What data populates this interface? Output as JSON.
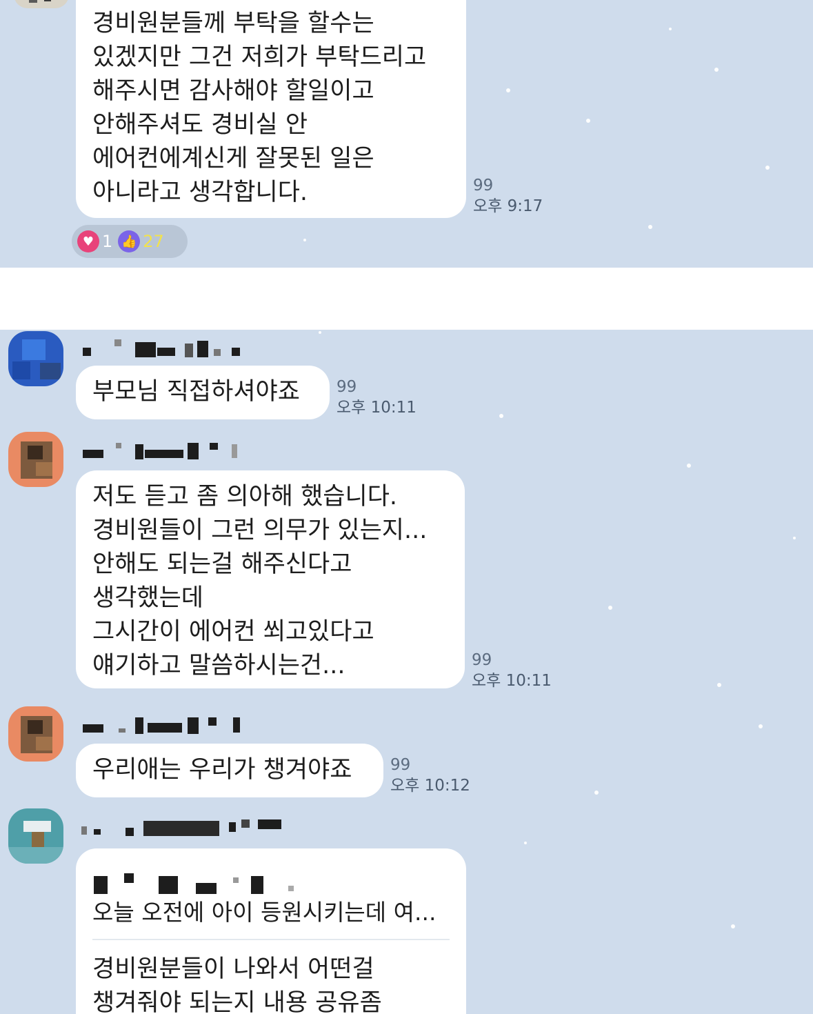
{
  "messages": [
    {
      "lines": [
        "경비원분들께 부탁을 할수는",
        "있겠지만 그건 저희가 부탁드리고",
        "해주시면 감사해야 할일이고",
        "안해주셔도 경비실 안",
        "에어컨에계신게 잘못된 일은",
        "아니라고 생각합니다."
      ],
      "unread": "99",
      "time": "오후 9:17",
      "reactions": {
        "heart": "1",
        "like": "27"
      }
    },
    {
      "lines": [
        "부모님 직접하셔야죠"
      ],
      "unread": "99",
      "time": "오후 10:11"
    },
    {
      "lines": [
        "저도 듣고 좀 의아해 했습니다.",
        "경비원들이 그런 의무가 있는지...",
        "안해도 되는걸 해주신다고",
        "생각했는데",
        "그시간이 에어컨 쐬고있다고",
        "얘기하고 말씀하시는건..."
      ],
      "unread": "99",
      "time": "오후 10:11"
    },
    {
      "lines": [
        "우리애는 우리가 챙겨야죠"
      ],
      "unread": "99",
      "time": "오후 10:12"
    },
    {
      "quote": "오늘 오전에 아이 등원시키는데 여...",
      "lines": [
        "경비원분들이 나와서 어떤걸",
        "챙겨줘야 되는지 내용 공유좀"
      ]
    }
  ],
  "colors": {
    "background": "#cfdcec",
    "bubble": "#ffffff",
    "heart": "#e8437a",
    "like": "#7b64e8"
  }
}
